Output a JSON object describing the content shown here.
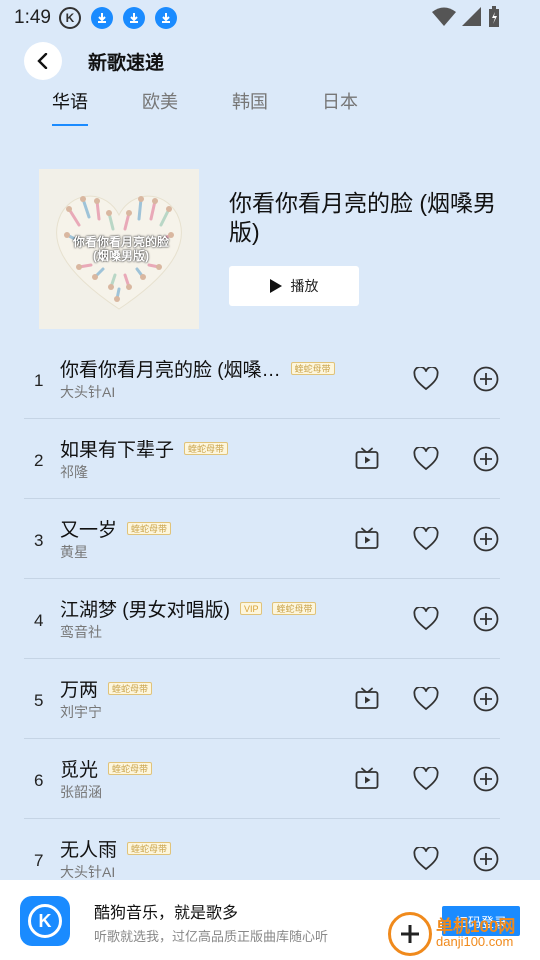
{
  "status_bar": {
    "time": "1:49",
    "k_badge": "K",
    "download_count": 3
  },
  "header": {
    "title": "新歌速递"
  },
  "tabs": [
    {
      "label": "华语",
      "active": true
    },
    {
      "label": "欧美",
      "active": false
    },
    {
      "label": "韩国",
      "active": false
    },
    {
      "label": "日本",
      "active": false
    }
  ],
  "hero": {
    "title": "你看你看月亮的脸 (烟嗓男版)",
    "cover_text": "你看你看月亮的脸(烟嗓男版)",
    "play_label": "播放"
  },
  "songs": [
    {
      "index": "1",
      "title": "你看你看月亮的脸 (烟嗓…",
      "artist": "大头针AI",
      "badges": [
        "蝰蛇母带"
      ],
      "has_mv": false
    },
    {
      "index": "2",
      "title": "如果有下辈子",
      "artist": "祁隆",
      "badges": [
        "蝰蛇母带"
      ],
      "has_mv": true
    },
    {
      "index": "3",
      "title": "又一岁",
      "artist": "黄星",
      "badges": [
        "蝰蛇母带"
      ],
      "has_mv": true
    },
    {
      "index": "4",
      "title": "江湖梦 (男女对唱版)",
      "artist": "鸾音社",
      "badges": [
        "VIP",
        "蝰蛇母带"
      ],
      "has_mv": false
    },
    {
      "index": "5",
      "title": "万两",
      "artist": "刘宇宁",
      "badges": [
        "蝰蛇母带"
      ],
      "has_mv": true
    },
    {
      "index": "6",
      "title": "觅光",
      "artist": "张韶涵",
      "badges": [
        "蝰蛇母带"
      ],
      "has_mv": true
    },
    {
      "index": "7",
      "title": "无人雨",
      "artist": "大头针AI",
      "badges": [
        "蝰蛇母带"
      ],
      "has_mv": false
    }
  ],
  "bottom_banner": {
    "title": "酷狗音乐，就是歌多",
    "subtitle": "听歌就选我，过亿高品质正版曲库随心听",
    "button_label": "扫码登录"
  },
  "watermark": {
    "name": "单机100网",
    "url": "danji100.com"
  },
  "colors": {
    "accent": "#1a8bff",
    "background": "#dbe9f9",
    "badge_gold": "#c9a34b"
  },
  "icons": {
    "back": "chevron-left-icon",
    "play": "play-icon",
    "mv": "tv-icon",
    "like": "heart-icon",
    "add": "plus-circle-icon",
    "download": "download-icon"
  }
}
